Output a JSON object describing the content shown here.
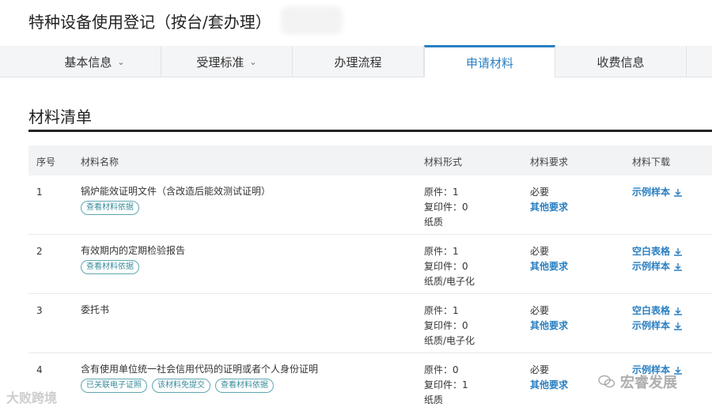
{
  "page": {
    "title": "特种设备使用登记（按台/套办理）"
  },
  "tabs": [
    {
      "label": "基本信息",
      "has_dropdown": true
    },
    {
      "label": "受理标准",
      "has_dropdown": true
    },
    {
      "label": "办理流程",
      "has_dropdown": false
    },
    {
      "label": "申请材料",
      "has_dropdown": false,
      "active": true
    },
    {
      "label": "收费信息",
      "has_dropdown": false
    }
  ],
  "section": {
    "title": "材料清单"
  },
  "table": {
    "headers": {
      "no": "序号",
      "name": "材料名称",
      "form": "材料形式",
      "req": "材料要求",
      "download": "材料下载"
    },
    "rows": [
      {
        "no": "1",
        "name": "锅炉能效证明文件（含改造后能效测试证明）",
        "pills": [
          "查看材料依据"
        ],
        "form": [
          "原件：1",
          "复印件：0",
          "纸质"
        ],
        "req_text": "必要",
        "req_link": "其他要求",
        "downloads": [
          "示例样本"
        ]
      },
      {
        "no": "2",
        "name": "有效期内的定期检验报告",
        "pills": [
          "查看材料依据"
        ],
        "form": [
          "原件：1",
          "复印件：0",
          "纸质/电子化"
        ],
        "req_text": "必要",
        "req_link": "其他要求",
        "downloads": [
          "空白表格",
          "示例样本"
        ]
      },
      {
        "no": "3",
        "name": "委托书",
        "pills": [],
        "form": [
          "原件：1",
          "复印件：0",
          "纸质/电子化"
        ],
        "req_text": "必要",
        "req_link": "其他要求",
        "downloads": [
          "空白表格",
          "示例样本"
        ]
      },
      {
        "no": "4",
        "name": "含有使用单位统一社会信用代码的证明或者个人身份证明",
        "pills": [
          "已关联电子证照",
          "该材料免提交",
          "查看材料依据"
        ],
        "form": [
          "原件：0",
          "复印件：1",
          "纸质"
        ],
        "req_text": "必要",
        "req_link": "其他要求",
        "downloads": [
          "示例样本"
        ]
      }
    ]
  },
  "watermarks": {
    "left": "大败跨境",
    "right": "宏睿发展"
  },
  "colors": {
    "accent": "#2a7fc1",
    "pill": "#5fa7b3"
  }
}
